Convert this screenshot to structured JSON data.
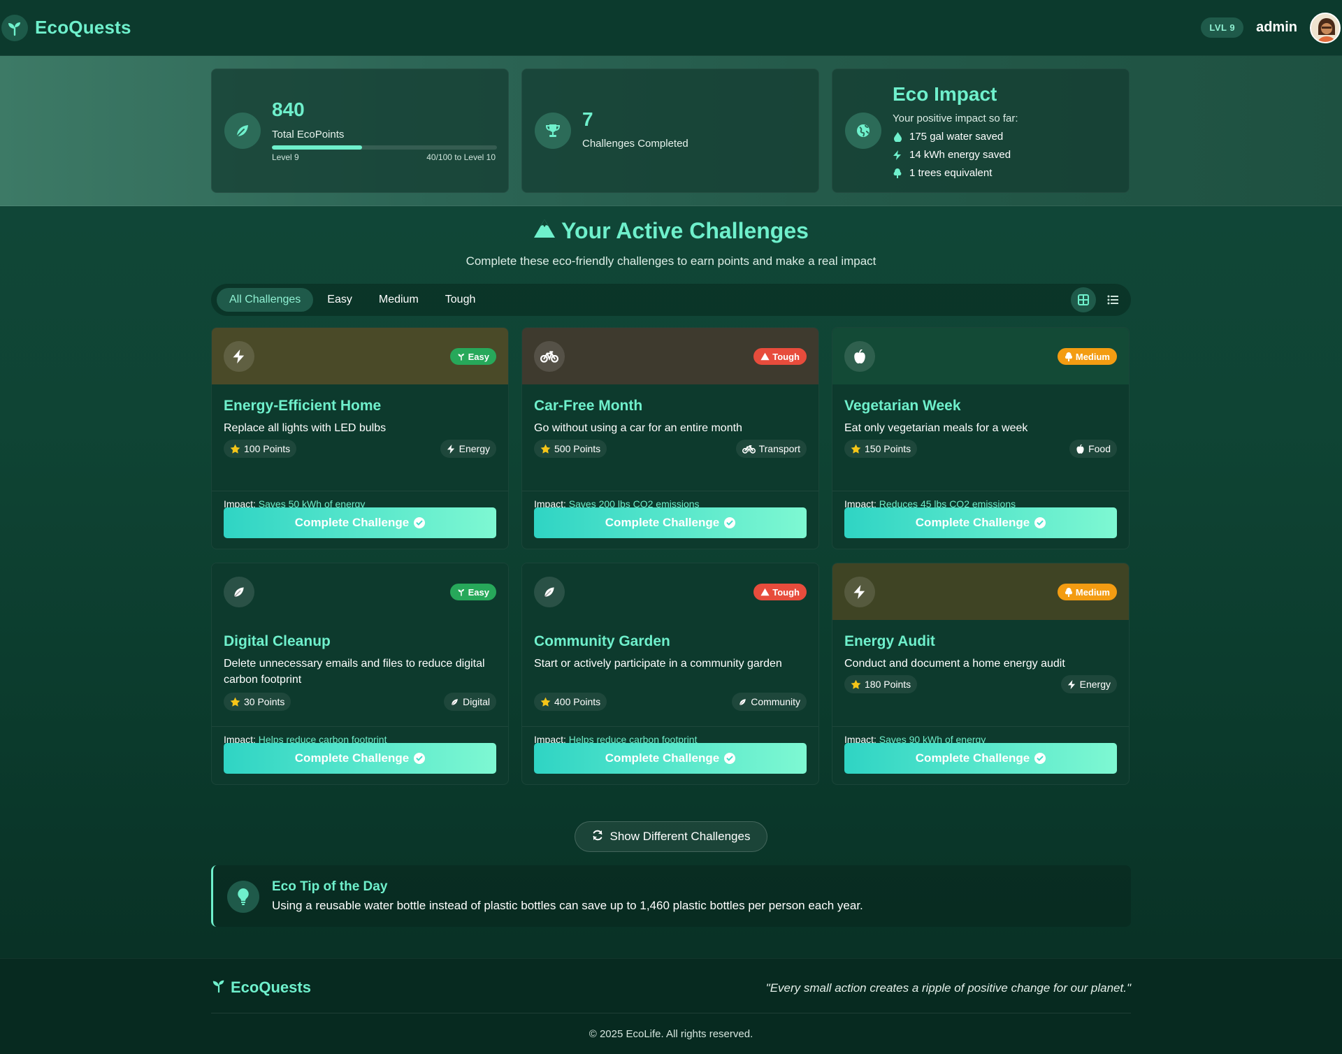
{
  "app": {
    "name": "EcoQuests"
  },
  "user": {
    "level_badge": "LVL 9",
    "name": "admin"
  },
  "stats": {
    "points": {
      "value": "840",
      "label": "Total EcoPoints",
      "level_text": "Level 9",
      "progress_text": "40/100 to Level 10",
      "progress_fraction": 0.4
    },
    "completed": {
      "value": "7",
      "label": "Challenges Completed"
    },
    "impact": {
      "title": "Eco Impact",
      "subtitle": "Your positive impact so far:",
      "items": [
        "175 gal water saved",
        "14 kWh energy saved",
        "1 trees equivalent"
      ]
    }
  },
  "section": {
    "title": "Your Active Challenges",
    "subtitle": "Complete these eco-friendly challenges to earn points and make a real impact"
  },
  "filters": [
    "All Challenges",
    "Easy",
    "Medium",
    "Tough"
  ],
  "active_filter": "All Challenges",
  "challenges": [
    {
      "title": "Energy-Efficient Home",
      "description": "Replace all lights with LED bulbs",
      "difficulty": "Easy",
      "points": "100 Points",
      "category": "Energy",
      "impact_label": "Impact:",
      "impact": "Saves 50 kWh of energy",
      "button": "Complete Challenge",
      "icon": "bolt-icon",
      "category_icon": "bolt-icon",
      "header_color": "#4a4a28"
    },
    {
      "title": "Car-Free Month",
      "description": "Go without using a car for an entire month",
      "difficulty": "Tough",
      "points": "500 Points",
      "category": "Transport",
      "impact_label": "Impact:",
      "impact": "Saves 200 lbs CO2 emissions",
      "button": "Complete Challenge",
      "icon": "bicycle-icon",
      "category_icon": "bicycle-icon",
      "header_color": "#3e3a2e"
    },
    {
      "title": "Vegetarian Week",
      "description": "Eat only vegetarian meals for a week",
      "difficulty": "Medium",
      "points": "150 Points",
      "category": "Food",
      "impact_label": "Impact:",
      "impact": "Reduces 45 lbs CO2 emissions",
      "button": "Complete Challenge",
      "icon": "apple-icon",
      "category_icon": "apple-icon",
      "header_color": "#134a36"
    },
    {
      "title": "Digital Cleanup",
      "description": "Delete unnecessary emails and files to reduce digital carbon footprint",
      "difficulty": "Easy",
      "points": "30 Points",
      "category": "Digital",
      "impact_label": "Impact:",
      "impact": "Helps reduce carbon footprint",
      "button": "Complete Challenge",
      "icon": "leaf-icon",
      "category_icon": "leaf-icon",
      "header_color": "#0d3a2d"
    },
    {
      "title": "Community Garden",
      "description": "Start or actively participate in a community garden",
      "difficulty": "Tough",
      "points": "400 Points",
      "category": "Community",
      "impact_label": "Impact:",
      "impact": "Helps reduce carbon footprint",
      "button": "Complete Challenge",
      "icon": "leaf-icon",
      "category_icon": "leaf-icon",
      "header_color": "#0d3a2d"
    },
    {
      "title": "Energy Audit",
      "description": "Conduct and document a home energy audit",
      "difficulty": "Medium",
      "points": "180 Points",
      "category": "Energy",
      "impact_label": "Impact:",
      "impact": "Saves 90 kWh of energy",
      "button": "Complete Challenge",
      "icon": "bolt-icon",
      "category_icon": "bolt-icon",
      "header_color": "#3f4424"
    }
  ],
  "difficulty_colors": {
    "Easy": "#27a85a",
    "Medium": "#f39c12",
    "Tough": "#e74c3c"
  },
  "show_different": "Show Different Challenges",
  "tip": {
    "title": "Eco Tip of the Day",
    "text": "Using a reusable water bottle instead of plastic bottles can save up to 1,460 plastic bottles per person each year."
  },
  "footer": {
    "brand": "EcoQuests",
    "quote": "\"Every small action creates a ripple of positive change for our planet.\"",
    "copyright": "© 2025 EcoLife. All rights reserved."
  }
}
